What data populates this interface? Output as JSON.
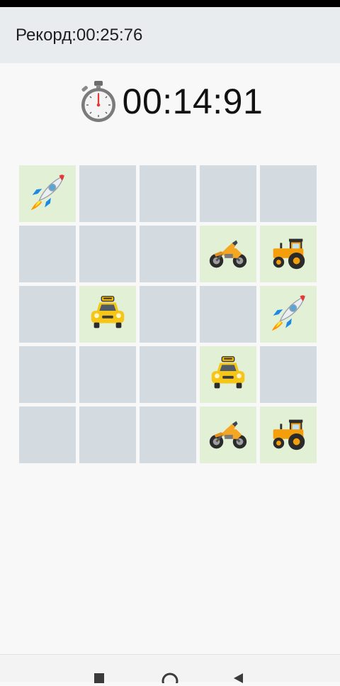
{
  "record": {
    "text": "Рекорд:00:25:76"
  },
  "timer": {
    "value": "00:14:91",
    "icon": "stopwatch-icon"
  },
  "board": {
    "rows": 5,
    "cols": 5,
    "cells": [
      [
        "rocket",
        null,
        null,
        null,
        null
      ],
      [
        null,
        null,
        null,
        "motorcycle",
        "tractor"
      ],
      [
        null,
        "taxi",
        null,
        null,
        "rocket"
      ],
      [
        null,
        null,
        null,
        "taxi",
        null
      ],
      [
        null,
        null,
        null,
        "motorcycle",
        "tractor"
      ]
    ]
  },
  "colors": {
    "hidden_tile": "#d3dae0",
    "open_tile": "#e2f0d6",
    "record_bar": "#e9ecef",
    "background": "#f8f8f8"
  },
  "navigation": {
    "buttons": [
      "square-icon",
      "circle-icon",
      "triangle-back-icon"
    ]
  }
}
